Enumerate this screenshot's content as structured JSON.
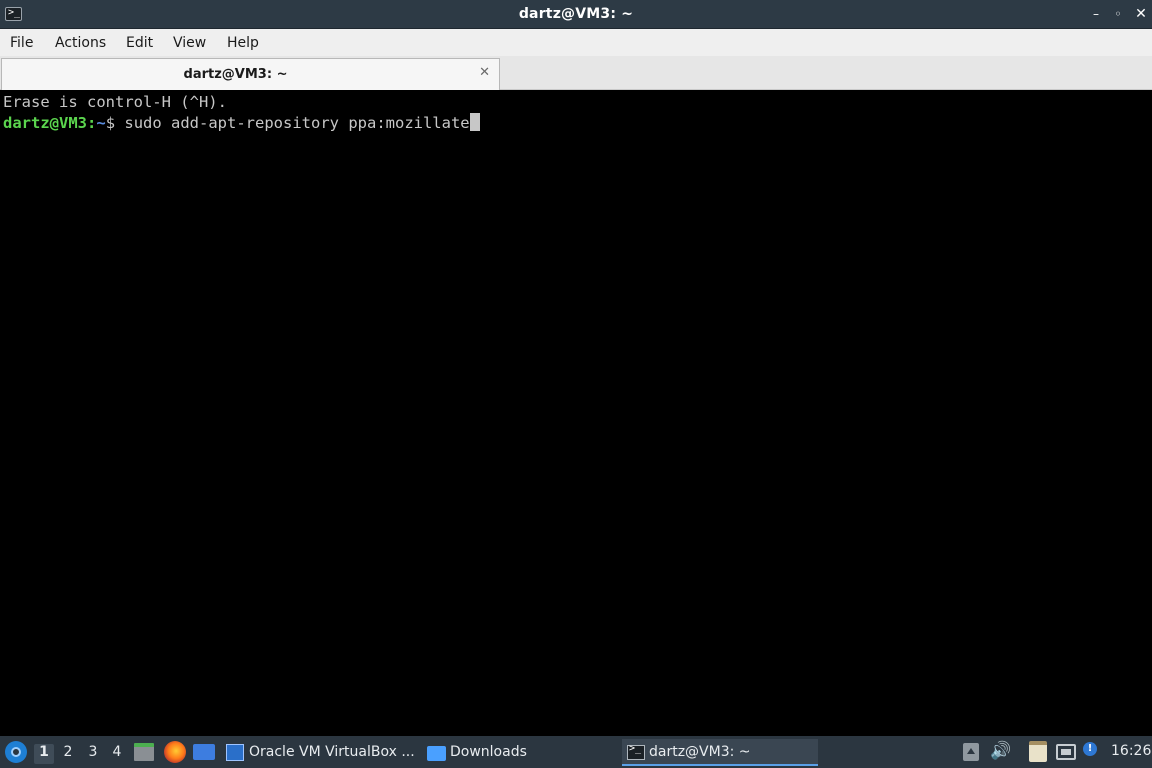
{
  "window": {
    "title": "dartz@VM3: ~",
    "app_icon_glyph": ">_",
    "buttons": {
      "minimize": "–",
      "maximize": "◦",
      "close": "✕"
    }
  },
  "menu": {
    "items": [
      "File",
      "Actions",
      "Edit",
      "View",
      "Help"
    ]
  },
  "tabs": [
    {
      "label": "dartz@VM3: ~",
      "close": "✕",
      "active": true
    }
  ],
  "terminal": {
    "line1": "Erase is control-H (^H).",
    "prompt_user": "dartz@VM3",
    "prompt_sep": ":",
    "prompt_path": "~",
    "prompt_symbol": "$ ",
    "command": "sudo add-apt-repository ppa:mozillate",
    "colors": {
      "background": "#000000",
      "text": "#c7c7c7",
      "user": "#5bd44e",
      "path": "#5a8de0"
    }
  },
  "taskbar": {
    "workspaces": [
      "1",
      "2",
      "3",
      "4"
    ],
    "active_workspace": "1",
    "quicklaunch": [
      "file-manager-icon",
      "firefox-icon",
      "show-desktop-icon"
    ],
    "tasks": [
      {
        "label": "Oracle VM VirtualBox ...",
        "icon": "virtualbox-icon"
      },
      {
        "label": "Downloads",
        "icon": "folder-icon"
      },
      {
        "label": "dartz@VM3: ~",
        "icon": "terminal-icon",
        "active": true
      }
    ],
    "tray": {
      "update_badge": "!",
      "volume_glyph": "🔊"
    },
    "clock": "16:26"
  }
}
